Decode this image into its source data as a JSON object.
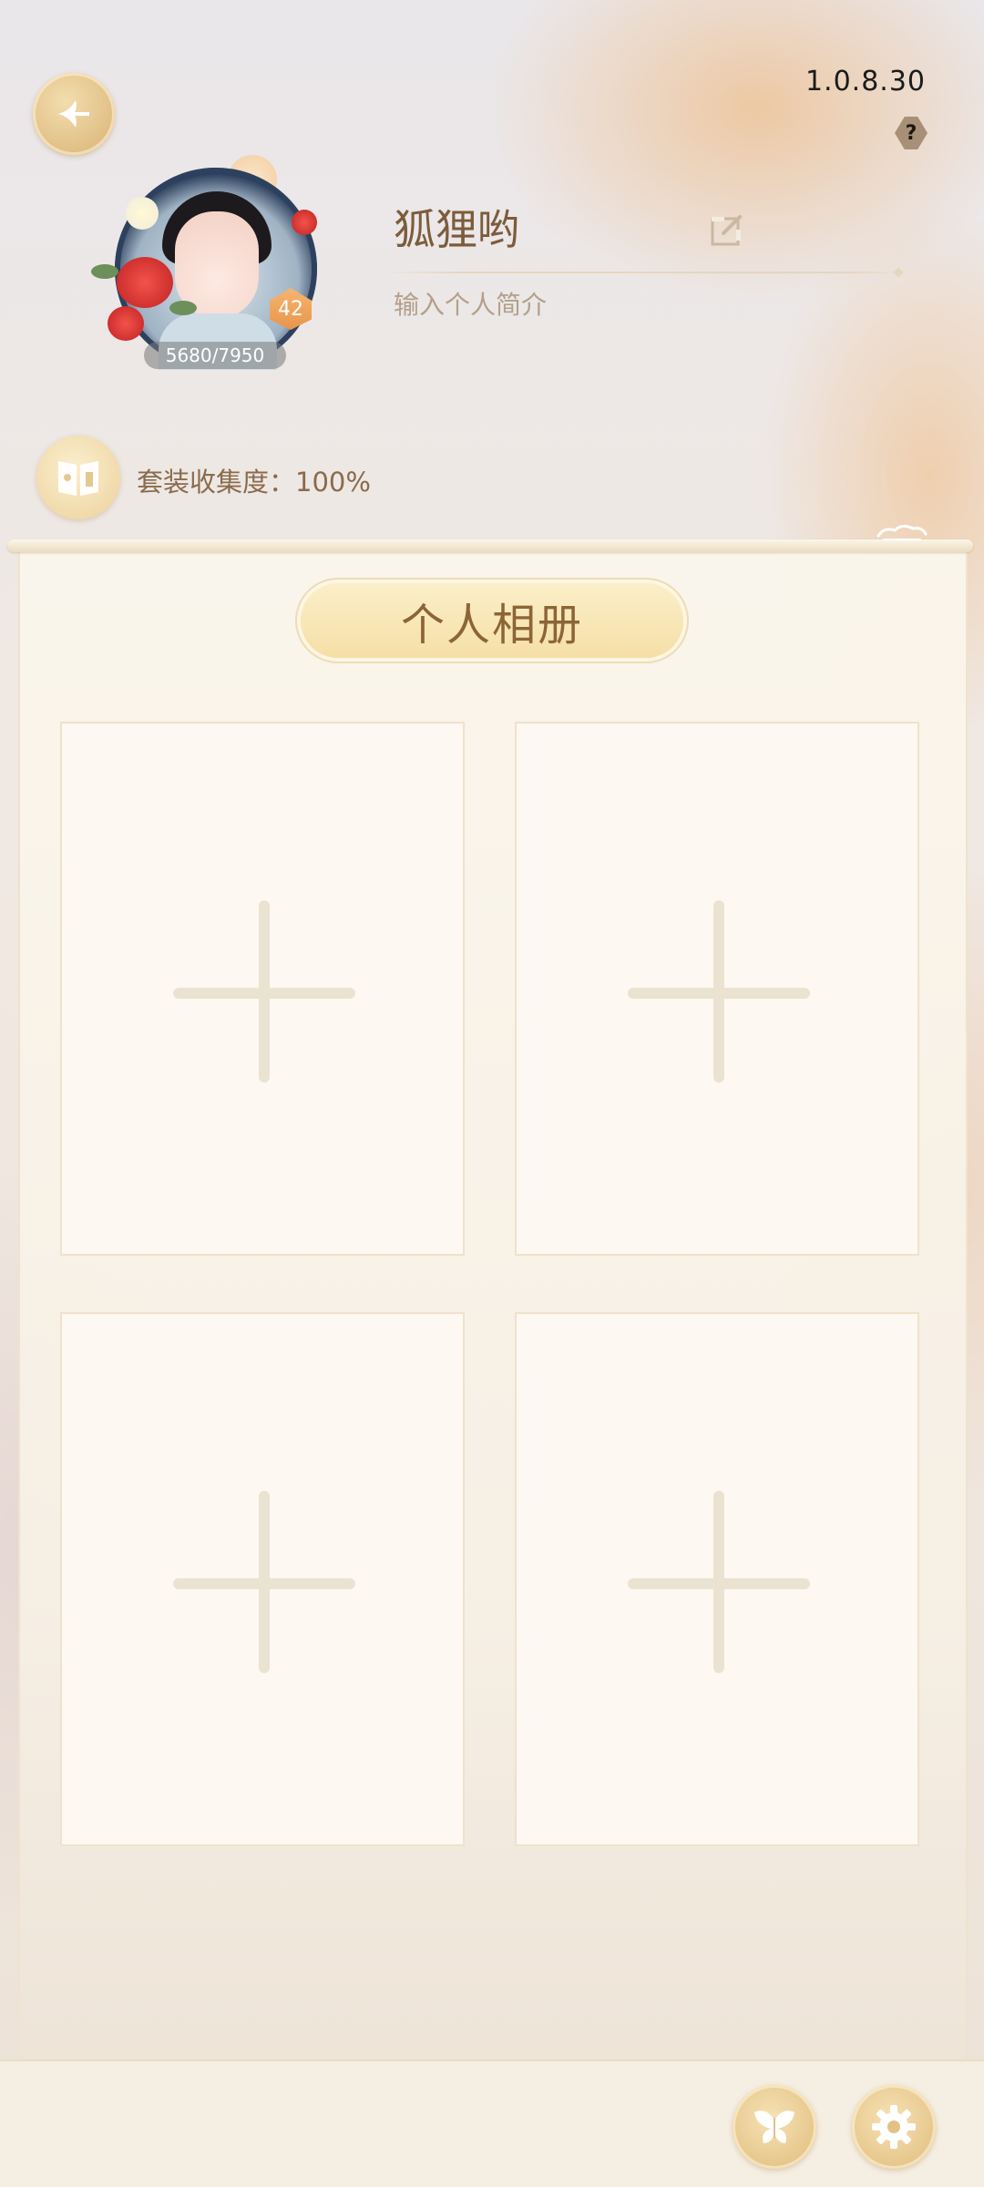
{
  "header": {
    "version": "1.0.8.30",
    "help_label": "?"
  },
  "profile": {
    "name": "狐狸哟",
    "bio_placeholder": "输入个人简介",
    "level": "42",
    "exp": "5680/7950",
    "collection_text": "套装收集度：100%"
  },
  "album": {
    "title": "个人相册",
    "slots": [
      {
        "icon": "plus-icon"
      },
      {
        "icon": "plus-icon"
      },
      {
        "icon": "plus-icon"
      },
      {
        "icon": "plus-icon"
      }
    ]
  },
  "bottom_bar": {
    "buttons": [
      {
        "icon": "butterfly-icon"
      },
      {
        "icon": "gear-icon"
      }
    ]
  },
  "colors": {
    "accent_gold": "#d8b273",
    "title_brown": "#8c6537",
    "name_brown": "#7b5c3b",
    "panel_bg": "#fbf6ec"
  }
}
